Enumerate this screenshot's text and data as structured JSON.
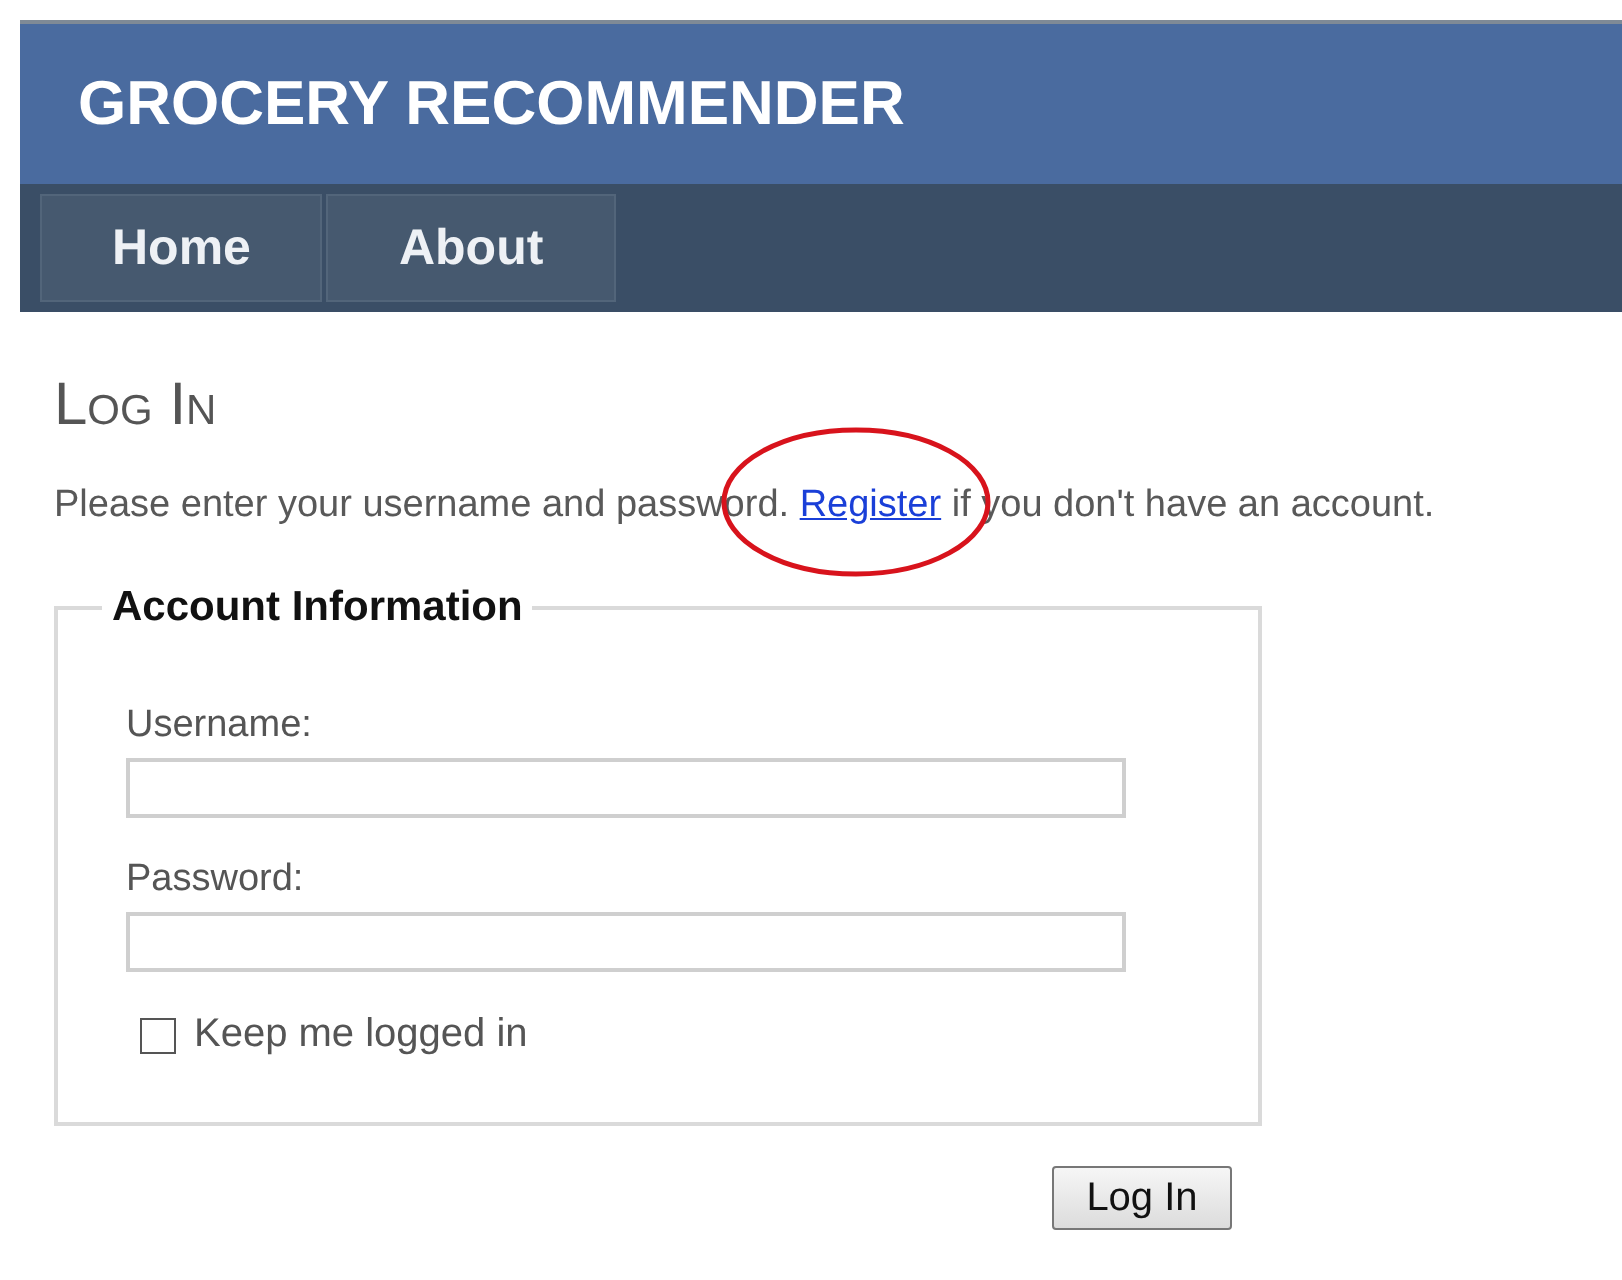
{
  "header": {
    "title": "GROCERY RECOMMENDER"
  },
  "nav": {
    "items": [
      {
        "label": "Home",
        "selected": false
      },
      {
        "label": "About",
        "selected": false
      }
    ]
  },
  "page": {
    "heading": "Log In",
    "intro": {
      "before": "Please enter your username and password. ",
      "link": "Register",
      "after": " if you don't have an account."
    }
  },
  "account": {
    "legend": "Account Information",
    "fields": [
      {
        "label": "Username:"
      },
      {
        "label": "Password:"
      }
    ],
    "remember": {
      "label": "Keep me logged in",
      "checked": false
    }
  },
  "submit": {
    "label": "Log In"
  }
}
